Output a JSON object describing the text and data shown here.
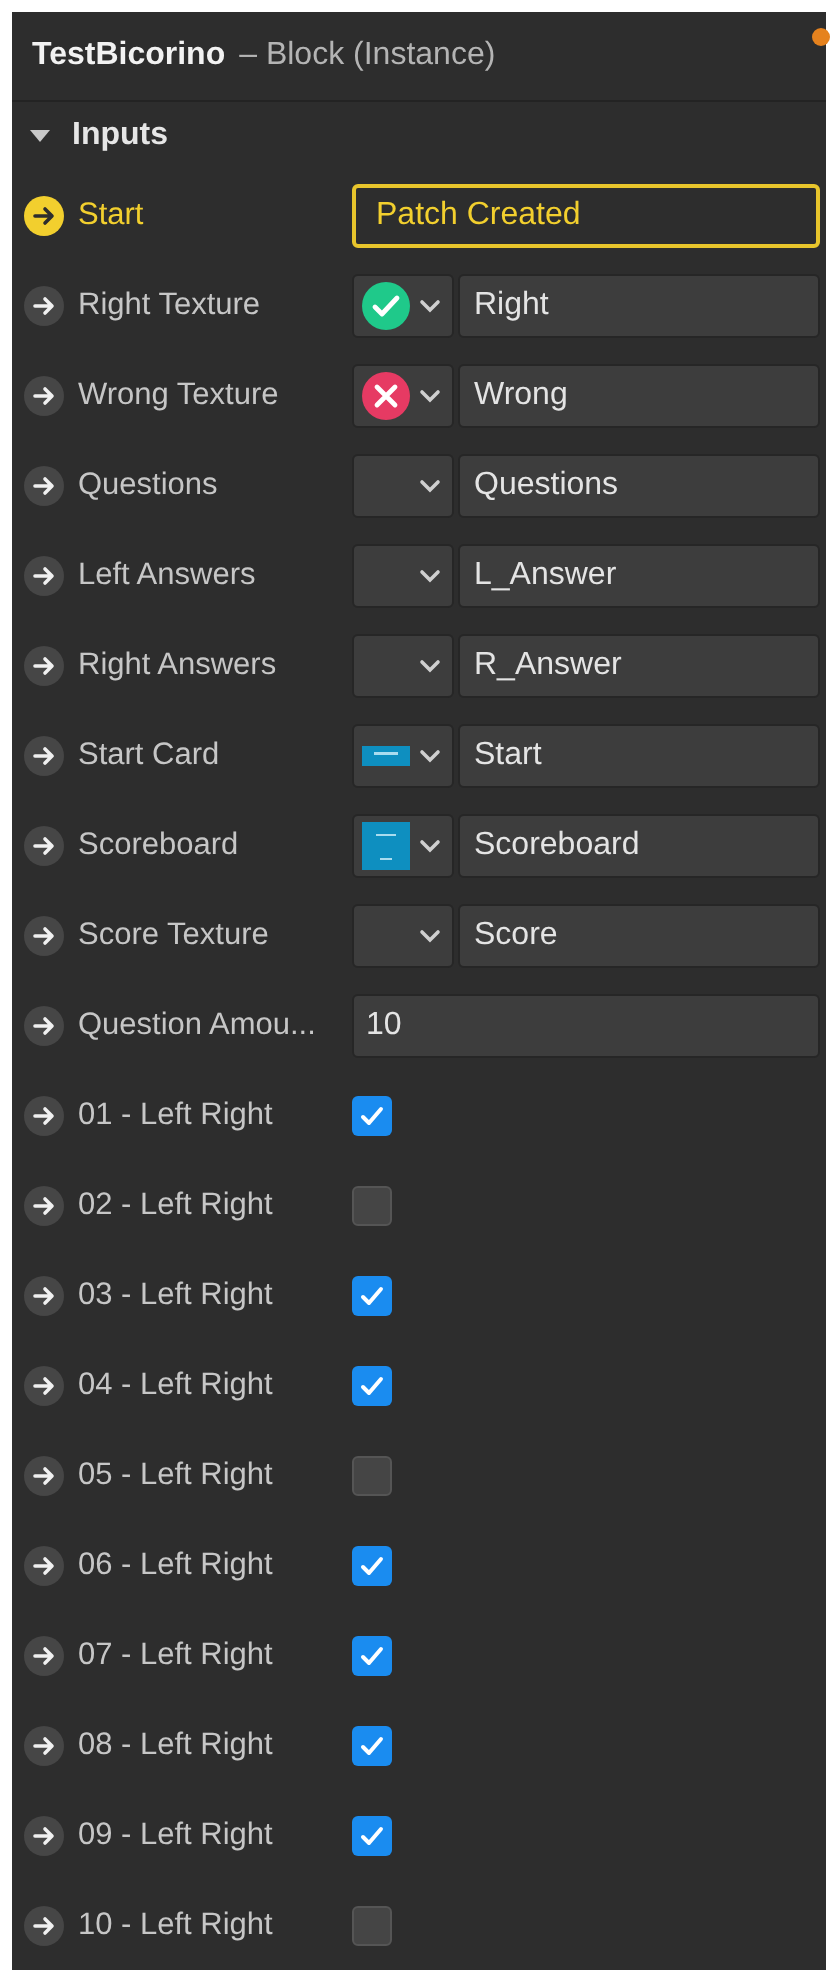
{
  "header": {
    "title": "TestBicorino",
    "subtitle": "– Block (Instance)",
    "modified": true
  },
  "section": {
    "label": "Inputs",
    "expanded": true
  },
  "inputs": [
    {
      "kind": "signal",
      "label": "Start",
      "value": "Patch Created"
    },
    {
      "kind": "asset",
      "label": "Right Texture",
      "thumbnail": {
        "kind": "check"
      },
      "value": "Right"
    },
    {
      "kind": "asset",
      "label": "Wrong Texture",
      "thumbnail": {
        "kind": "cross"
      },
      "value": "Wrong"
    },
    {
      "kind": "asset",
      "label": "Questions",
      "value": "Questions"
    },
    {
      "kind": "asset",
      "label": "Left Answers",
      "value": "L_Answer"
    },
    {
      "kind": "asset",
      "label": "Right Answers",
      "value": "R_Answer"
    },
    {
      "kind": "asset",
      "label": "Start Card",
      "thumbnail": {
        "kind": "banner"
      },
      "value": "Start"
    },
    {
      "kind": "asset",
      "label": "Scoreboard",
      "thumbnail": {
        "kind": "board"
      },
      "value": "Scoreboard"
    },
    {
      "kind": "asset",
      "label": "Score Texture",
      "value": "Score"
    },
    {
      "kind": "number",
      "label": "Question Amou...",
      "value": "10"
    },
    {
      "kind": "checkbox",
      "label": "01 - Left Right",
      "checked": true
    },
    {
      "kind": "checkbox",
      "label": "02 - Left Right",
      "checked": false
    },
    {
      "kind": "checkbox",
      "label": "03 - Left Right",
      "checked": true
    },
    {
      "kind": "checkbox",
      "label": "04 - Left Right",
      "checked": true
    },
    {
      "kind": "checkbox",
      "label": "05 - Left Right",
      "checked": false
    },
    {
      "kind": "checkbox",
      "label": "06 - Left Right",
      "checked": true
    },
    {
      "kind": "checkbox",
      "label": "07 - Left Right",
      "checked": true
    },
    {
      "kind": "checkbox",
      "label": "08 - Left Right",
      "checked": true
    },
    {
      "kind": "checkbox",
      "label": "09 - Left Right",
      "checked": true
    },
    {
      "kind": "checkbox",
      "label": "10 - Left Right",
      "checked": false
    }
  ]
}
